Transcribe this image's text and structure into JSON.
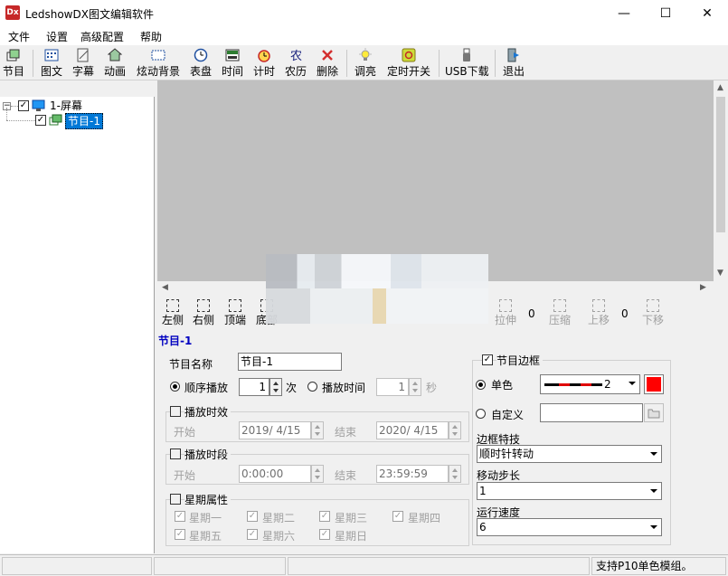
{
  "window": {
    "icon_text": "Dx",
    "title": "LedshowDX图文编辑软件",
    "minimize": "—",
    "maximize": "☐",
    "close": "✕"
  },
  "menu": [
    "文件",
    "设置",
    "高级配置",
    "帮助"
  ],
  "toolbar": {
    "program": "节目",
    "image_text": "图文",
    "subtitle": "字幕",
    "animation": "动画",
    "dynamic_bg": "炫动背景",
    "dial": "表盘",
    "time": "时间",
    "timer": "计时",
    "lunar": "农历",
    "delete": "删除",
    "brightness": "调亮",
    "timed_switch": "定时开关",
    "usb_download": "USB下载",
    "exit": "退出"
  },
  "tree": {
    "screen": "1-屏幕",
    "program": "节目-1"
  },
  "align_toolbar": {
    "left": "左侧",
    "right": "右侧",
    "top": "顶端",
    "bottom": "底部",
    "stretch": "拉伸",
    "stretch_value": "0",
    "compress": "压缩",
    "move_up": "上移",
    "move_value": "0",
    "move_down": "下移"
  },
  "properties": {
    "title": "节目-1",
    "name_label": "节目名称",
    "name_value": "节目-1",
    "sequential_label": "顺序播放",
    "sequential_count": "1",
    "times_unit": "次",
    "play_time_label": "播放时间",
    "play_time_value": "1",
    "seconds_unit": "秒",
    "validity": {
      "label": "播放时效",
      "start_label": "开始",
      "start_value": "2019/ 4/15",
      "end_label": "结束",
      "end_value": "2020/ 4/15"
    },
    "period": {
      "label": "播放时段",
      "start_label": "开始",
      "start_value": "0:00:00",
      "end_label": "结束",
      "end_value": "23:59:59"
    },
    "weekday": {
      "label": "星期属性",
      "days": [
        "星期一",
        "星期二",
        "星期三",
        "星期四",
        "星期五",
        "星期六",
        "星期日"
      ]
    },
    "border": {
      "label": "节目边框",
      "single_color_label": "单色",
      "line_width": "2",
      "custom_label": "自定义",
      "effect_label": "边框特技",
      "effect_value": "顺时针转动",
      "step_label": "移动步长",
      "step_value": "1",
      "speed_label": "运行速度",
      "speed_value": "6",
      "color": "#ff0000"
    }
  },
  "status": {
    "message": "支持P10单色模组。"
  }
}
